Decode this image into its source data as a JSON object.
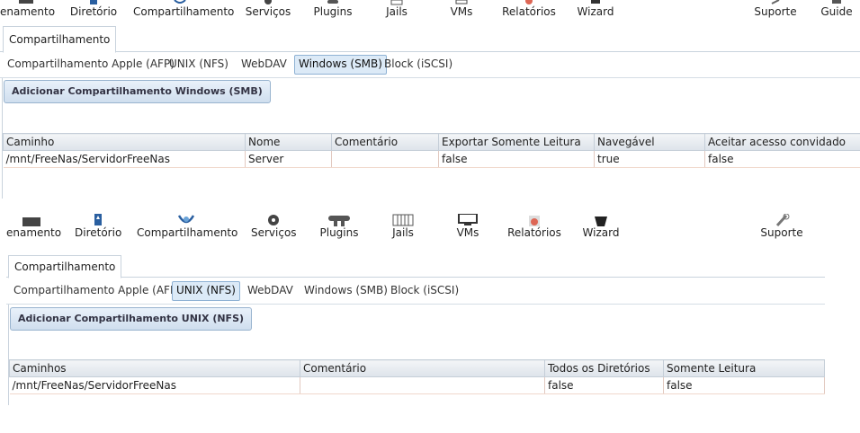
{
  "panel1": {
    "nav": [
      {
        "label": "enamento",
        "icon": "armazenamento-icon"
      },
      {
        "label": "Diretório",
        "icon": "directory-icon"
      },
      {
        "label": "Compartilhamento",
        "icon": "sharing-icon"
      },
      {
        "label": "Serviços",
        "icon": "services-icon"
      },
      {
        "label": "Plugins",
        "icon": "plugins-icon"
      },
      {
        "label": "Jails",
        "icon": "jails-icon"
      },
      {
        "label": "VMs",
        "icon": "vms-icon"
      },
      {
        "label": "Relatórios",
        "icon": "reports-icon"
      },
      {
        "label": "Wizard",
        "icon": "wizard-icon"
      },
      {
        "label": "Suporte",
        "icon": "support-icon"
      },
      {
        "label": "Guide",
        "icon": "guide-icon"
      }
    ],
    "main_tab": "Compartilhamento",
    "subtabs": [
      "Compartilhamento Apple (AFP)",
      "UNIX (NFS)",
      "WebDAV",
      "Windows (SMB)",
      "Block (iSCSI)"
    ],
    "active_subtab": "Windows (SMB)",
    "add_button": "Adicionar Compartilhamento Windows (SMB)",
    "table": {
      "columns": [
        "Caminho",
        "Nome",
        "Comentário",
        "Exportar Somente Leitura",
        "Navegável",
        "Aceitar acesso convidado"
      ],
      "rows": [
        [
          "/mnt/FreeNas/ServidorFreeNas",
          "Server",
          "",
          "false",
          "true",
          "false"
        ]
      ]
    }
  },
  "panel2": {
    "nav": [
      {
        "label": "enamento",
        "icon": "armazenamento-icon"
      },
      {
        "label": "Diretório",
        "icon": "directory-icon"
      },
      {
        "label": "Compartilhamento",
        "icon": "sharing-icon"
      },
      {
        "label": "Serviços",
        "icon": "services-icon"
      },
      {
        "label": "Plugins",
        "icon": "plugins-icon"
      },
      {
        "label": "Jails",
        "icon": "jails-icon"
      },
      {
        "label": "VMs",
        "icon": "vms-icon"
      },
      {
        "label": "Relatórios",
        "icon": "reports-icon"
      },
      {
        "label": "Wizard",
        "icon": "wizard-icon"
      },
      {
        "label": "Suporte",
        "icon": "support-icon"
      }
    ],
    "main_tab": "Compartilhamento",
    "subtabs": [
      "Compartilhamento Apple (AFP)",
      "UNIX (NFS)",
      "WebDAV",
      "Windows (SMB)",
      "Block (iSCSI)"
    ],
    "active_subtab": "UNIX (NFS)",
    "add_button": "Adicionar Compartilhamento UNIX (NFS)",
    "table": {
      "columns": [
        "Caminhos",
        "Comentário",
        "Todos os Diretórios",
        "Somente Leitura"
      ],
      "rows": [
        [
          "/mnt/FreeNas/ServidorFreeNas",
          "",
          "false",
          "false"
        ]
      ]
    }
  },
  "colors": {
    "accent": "#8fb2d4",
    "active_tab_bg": "#dceaf7",
    "header_border": "#c5ced8"
  }
}
